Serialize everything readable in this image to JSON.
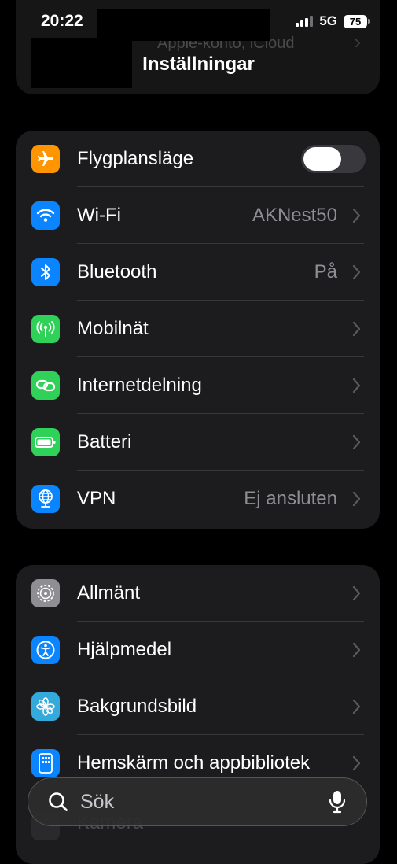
{
  "status_bar": {
    "time": "20:22",
    "network": "5G",
    "battery": "75"
  },
  "header": {
    "title": "Inställningar",
    "account_subtitle": "Apple-konto, iCloud"
  },
  "group1": [
    {
      "id": "airplane",
      "label": "Flygplansläge",
      "value": "",
      "icon": "airplane-icon",
      "color": "#ff9500",
      "toggle": true,
      "toggle_on": false
    },
    {
      "id": "wifi",
      "label": "Wi-Fi",
      "value": "AKNest50",
      "icon": "wifi-icon",
      "color": "#0a84ff"
    },
    {
      "id": "bluetooth",
      "label": "Bluetooth",
      "value": "På",
      "icon": "bluetooth-icon",
      "color": "#0a84ff"
    },
    {
      "id": "mobile",
      "label": "Mobilnät",
      "value": "",
      "icon": "antenna-icon",
      "color": "#30d158"
    },
    {
      "id": "hotspot",
      "label": "Internetdelning",
      "value": "",
      "icon": "link-icon",
      "color": "#30d158"
    },
    {
      "id": "battery",
      "label": "Batteri",
      "value": "",
      "icon": "battery-icon",
      "color": "#30d158"
    },
    {
      "id": "vpn",
      "label": "VPN",
      "value": "Ej ansluten",
      "icon": "globe-icon",
      "color": "#0a84ff"
    }
  ],
  "group2": [
    {
      "id": "general",
      "label": "Allmänt",
      "icon": "gear-icon",
      "color": "#8e8e93"
    },
    {
      "id": "accessibility",
      "label": "Hjälpmedel",
      "icon": "accessibility-icon",
      "color": "#0a84ff"
    },
    {
      "id": "wallpaper",
      "label": "Bakgrundsbild",
      "icon": "flower-icon",
      "color": "#34aadc"
    },
    {
      "id": "homescreen",
      "label": "Hemskärm och appbibliotek",
      "icon": "homescreen-icon",
      "color": "#0a84ff"
    }
  ],
  "partial_row": {
    "label": "Kamera"
  },
  "search": {
    "placeholder": "Sök"
  }
}
